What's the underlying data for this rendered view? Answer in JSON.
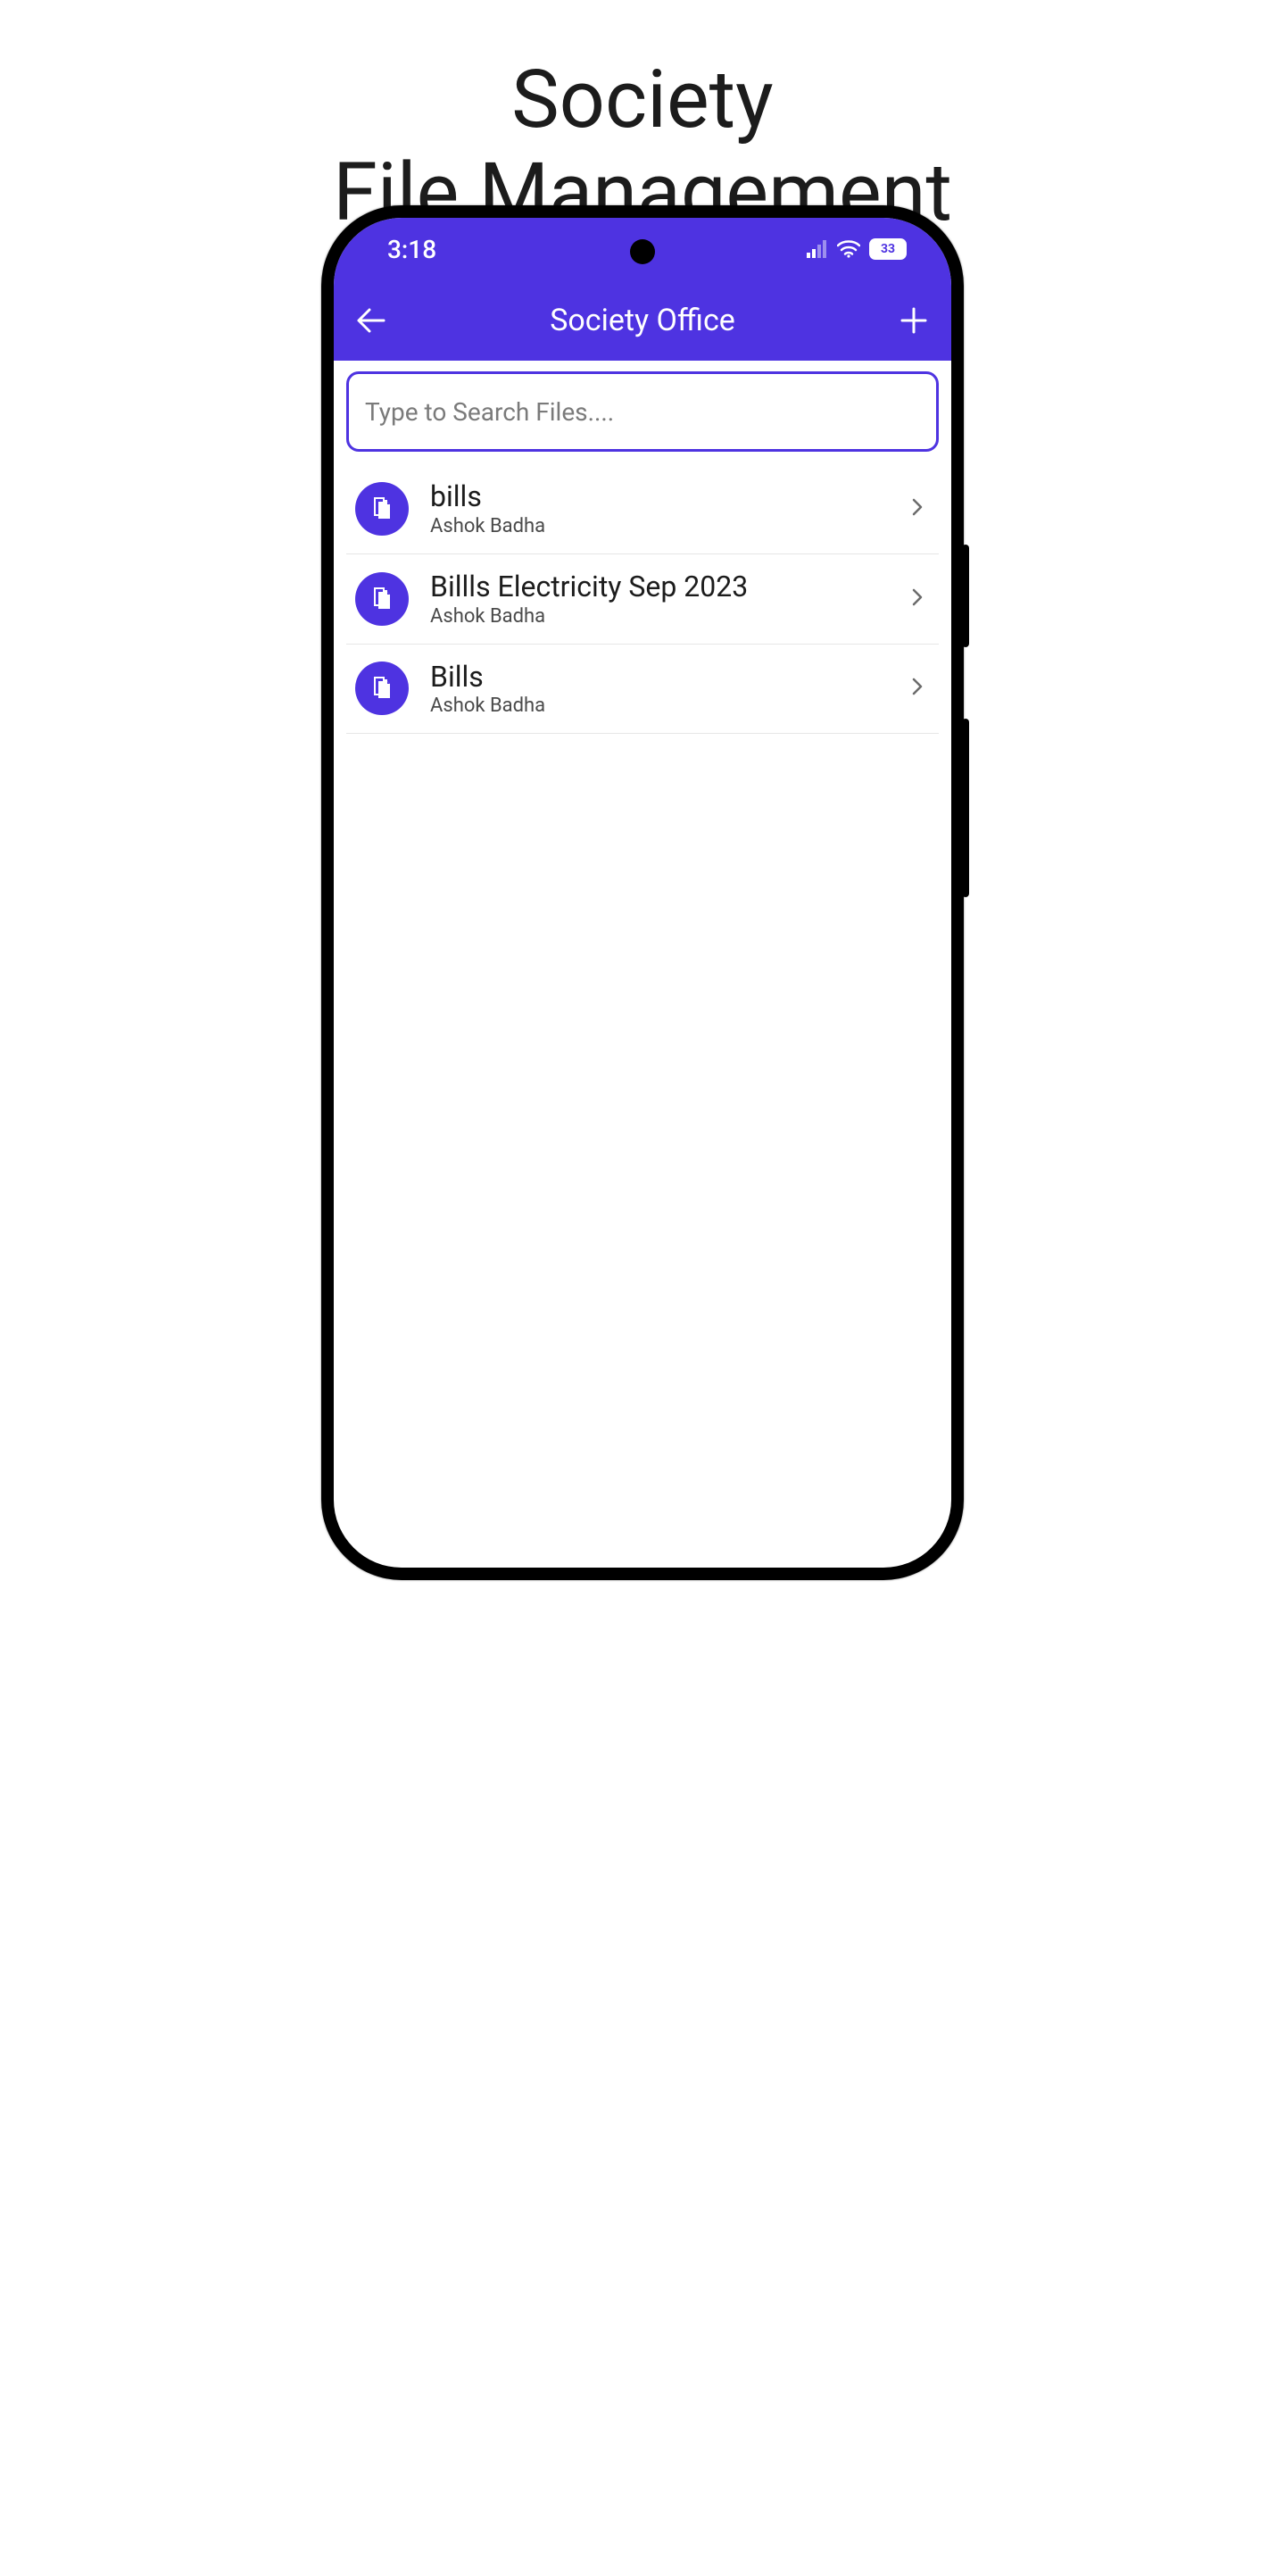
{
  "heading": {
    "line1": "Society",
    "line2": "File Management"
  },
  "status": {
    "time": "3:18",
    "battery": "33"
  },
  "appbar": {
    "title": "Society Office"
  },
  "search": {
    "placeholder": "Type to Search Files....",
    "value": ""
  },
  "files": [
    {
      "title": "bills",
      "owner": "Ashok Badha"
    },
    {
      "title": "Billls Electricity Sep 2023",
      "owner": "Ashok Badha"
    },
    {
      "title": "Bills",
      "owner": "Ashok Badha"
    }
  ],
  "colors": {
    "primary": "#4e33e1"
  }
}
